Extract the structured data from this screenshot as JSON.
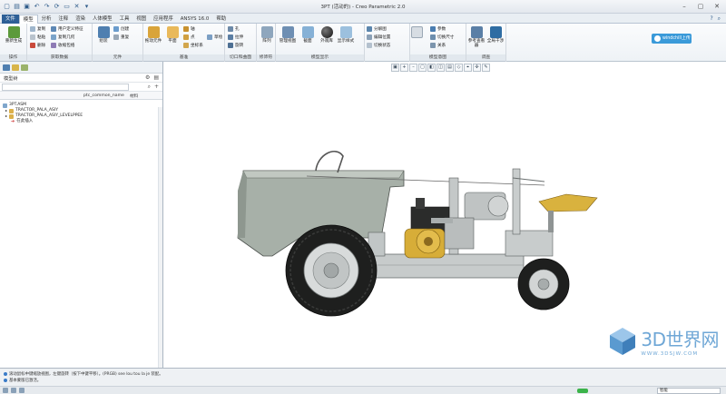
{
  "window": {
    "title": "3PT (活动的) - Creo Parametric 2.0"
  },
  "menu": {
    "file": "文件",
    "tabs": [
      "模型",
      "分析",
      "注释",
      "渲染",
      "人体模型",
      "工具",
      "视图",
      "应用程序",
      "ANSYS 16.0",
      "帮助"
    ]
  },
  "ribbon": {
    "groups": [
      "操作",
      "获取数据",
      "元件",
      "基准",
      "切口和曲面",
      "修饰符",
      "模型显示",
      "模型意图",
      "调查"
    ],
    "buttons": {
      "regenerate": "重新生成",
      "copy": "复制",
      "paste": "粘贴",
      "delete": "删除",
      "user_feature": "用户定义特征",
      "copy_geometry": "复制几何",
      "shrinkwrap": "收缩包络",
      "assemble": "组装",
      "create": "创建",
      "repeat": "重复",
      "drag": "拖动元件",
      "plane": "平面",
      "axis": "轴",
      "point": "点",
      "coord": "坐标系",
      "sketch": "草绘",
      "hole": "孔",
      "extrude_cut": "拉伸",
      "revolve": "旋转",
      "array": "阵列",
      "manage_views": "管理视图",
      "section": "截面",
      "appearance": "外观库",
      "display_style": "显示样式",
      "explode": "分解图",
      "edit_pos": "编辑位置",
      "toggle_status": "切换状态",
      "params": "参数",
      "relations": "关系",
      "switch_dims": "切换尺寸",
      "ref_viewer": "参考查看器",
      "global_interference": "全局干涉",
      "bill": "材料清单",
      "cloud_upload": "windchill上传"
    }
  },
  "model_tree": {
    "header": "模型树",
    "search_placeholder": "",
    "columns": [
      "ptc_common_name",
      "材料"
    ],
    "items": [
      {
        "label": "3PT.ASM",
        "type": "asm"
      },
      {
        "label": "TRACTOR_PALA_ASIY",
        "type": "sub"
      },
      {
        "label": "TRACTOR_PALA_ASIY_LEVELPPEE",
        "type": "sub"
      },
      {
        "label": "在此插入",
        "type": "insert"
      }
    ]
  },
  "status": {
    "messages": [
      "滚动鼠标中键缩放视图，左键旋转（按下中键平移）。(PRGB) see lou tou la je 装配。",
      "基本蒙版已激活。"
    ],
    "filter": "智能"
  },
  "watermark": {
    "main": "3D世界网",
    "sub": "WWW.3DSJW.COM"
  },
  "colors": {
    "accent": "#2d5f96",
    "body_green": "#a8b2aa",
    "frame_grey": "#c4c8c8",
    "engine_yellow": "#e0b43c",
    "tire": "#1e1f1e"
  }
}
